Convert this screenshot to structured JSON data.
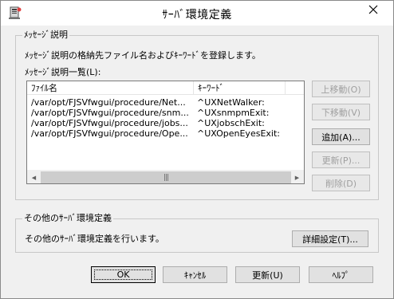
{
  "window": {
    "title": "ｻｰﾊﾞ環境定義",
    "close_glyph": "✕"
  },
  "message_group": {
    "label": "ﾒｯｾｰｼﾞ説明",
    "description": "ﾒｯｾｰｼﾞ説明の格納先ファイル名およびｷｰﾜｰﾄﾞを登録します。",
    "list_label": "ﾒｯｾｰｼﾞ説明一覧(L):",
    "columns": [
      "ﾌｧｲﾙ名",
      "ｷｰﾜｰﾄﾞ"
    ],
    "rows": [
      [
        "/var/opt/FJSVfwgui/procedure/Net...",
        "^UXNetWalker:"
      ],
      [
        "/var/opt/FJSVfwgui/procedure/snm...",
        "^UXsnmpmExit:"
      ],
      [
        "/var/opt/FJSVfwgui/procedure/jobs...",
        "^UXjobschExit:"
      ],
      [
        "/var/opt/FJSVfwgui/procedure/Ope...",
        "^UXOpenEyesExit:"
      ]
    ],
    "buttons": {
      "up": "上移動(O)",
      "down": "下移動(V)",
      "add": "追加(A)...",
      "update": "更新(P)...",
      "delete": "削除(D)"
    },
    "scroll_left": "◀",
    "scroll_right": "▶",
    "scroll_grip": "|||"
  },
  "other_group": {
    "label": "その他のｻｰﾊﾞ環境定義",
    "description": "その他のｻｰﾊﾞ環境定義を行います。",
    "detail_button": "詳細設定(T)..."
  },
  "footer": {
    "ok": "OK",
    "cancel": "ｷｬﾝｾﾙ",
    "update": "更新(U)",
    "help": "ﾍﾙﾌﾟ"
  }
}
